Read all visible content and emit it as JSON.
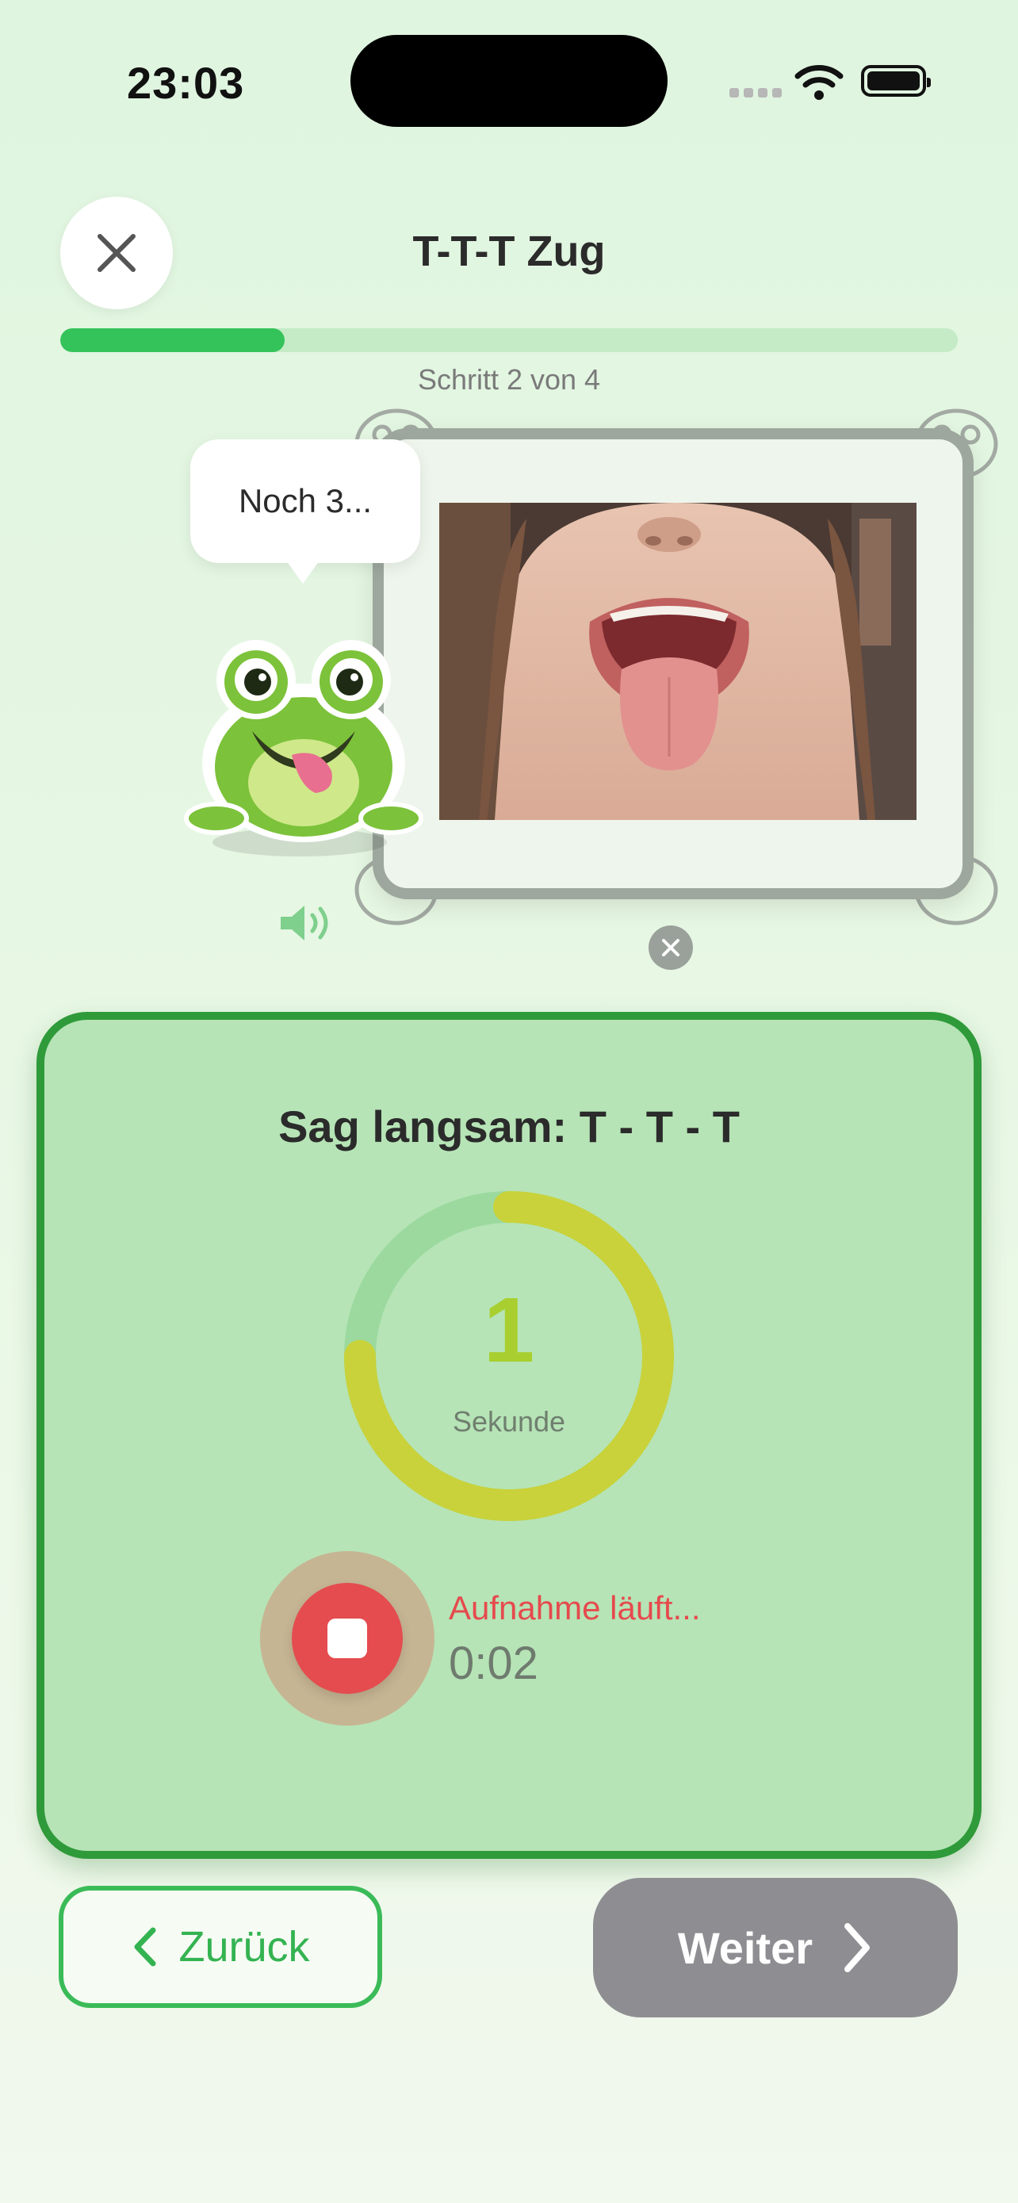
{
  "status_bar": {
    "time": "23:03",
    "icons": [
      "cellular-signal-icon",
      "wifi-icon",
      "battery-icon"
    ]
  },
  "header": {
    "title": "T-T-T Zug",
    "close_icon": "close-icon",
    "progress": {
      "current": 2,
      "total": 4,
      "fraction": 0.25
    },
    "step_label": "Schritt 2 von 4"
  },
  "media": {
    "speech_bubble": "Noch 3...",
    "mascot": "frog-mascot",
    "photo_subject": "child-showing-tongue",
    "speaker_icon": "speaker-icon",
    "close_icon": "close-icon"
  },
  "exercise": {
    "instruction": "Sag langsam: T - T - T",
    "timer_value": "1",
    "timer_unit": "Sekunde",
    "timer_remaining_fraction": 0.75,
    "recording_status": "Aufnahme läuft...",
    "recording_time": "0:02"
  },
  "navigation": {
    "back_label": "Zurück",
    "next_label": "Weiter"
  },
  "colors": {
    "accent_green": "#34c35a",
    "card_border": "#2f9a3a",
    "card_background": "#b6e4b6",
    "timer_ring": "#c9d23a",
    "record_red": "#e44c4f",
    "next_button": "#8e8e92"
  }
}
